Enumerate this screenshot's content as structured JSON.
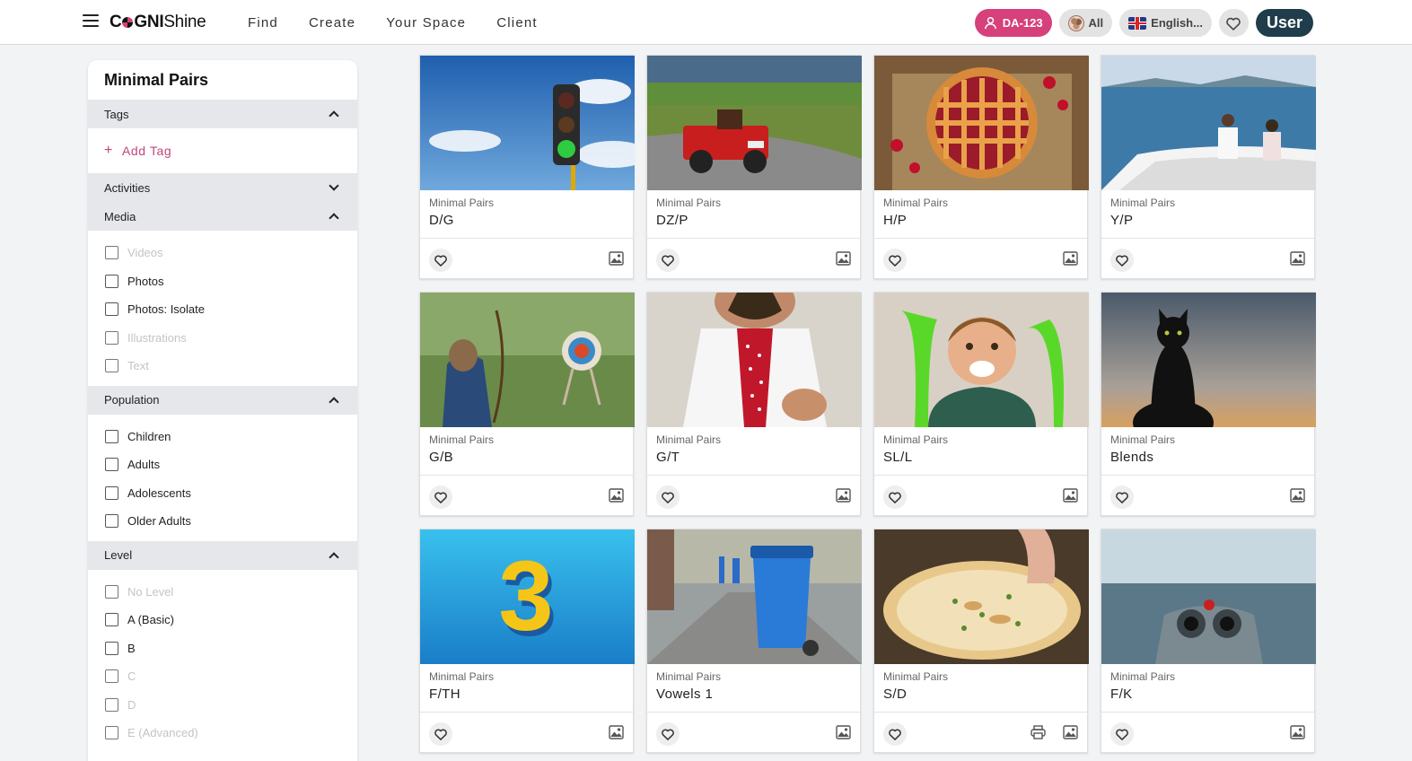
{
  "header": {
    "logo": {
      "part1": "C",
      "part2": "GNI",
      "part3": "Shine"
    },
    "nav": [
      "Find",
      "Create",
      "Your Space",
      "Client"
    ],
    "account_badge": "DA-123",
    "filter_all": "All",
    "language": "English...",
    "user_button": "User"
  },
  "sidebar": {
    "title": "Minimal Pairs",
    "sections": {
      "tags": "Tags",
      "add_tag": "Add Tag",
      "activities": "Activities",
      "media": "Media",
      "population": "Population",
      "level": "Level"
    },
    "media_options": [
      {
        "label": "Videos",
        "disabled": true
      },
      {
        "label": "Photos",
        "disabled": false
      },
      {
        "label": "Photos: Isolate",
        "disabled": false
      },
      {
        "label": "Illustrations",
        "disabled": true
      },
      {
        "label": "Text",
        "disabled": true
      }
    ],
    "population_options": [
      {
        "label": "Children",
        "disabled": false
      },
      {
        "label": "Adults",
        "disabled": false
      },
      {
        "label": "Adolescents",
        "disabled": false
      },
      {
        "label": "Older Adults",
        "disabled": false
      }
    ],
    "level_options": [
      {
        "label": "No Level",
        "disabled": true
      },
      {
        "label": "A (Basic)",
        "disabled": false
      },
      {
        "label": "B",
        "disabled": false
      },
      {
        "label": "C",
        "disabled": true
      },
      {
        "label": "D",
        "disabled": true
      },
      {
        "label": "E (Advanced)",
        "disabled": true
      }
    ]
  },
  "cards": [
    {
      "category": "Minimal Pairs",
      "title": "D/G",
      "image": "traffic-light"
    },
    {
      "category": "Minimal Pairs",
      "title": "DZ/P",
      "image": "red-jeep"
    },
    {
      "category": "Minimal Pairs",
      "title": "H/P",
      "image": "cherry-pie"
    },
    {
      "category": "Minimal Pairs",
      "title": "Y/P",
      "image": "yacht"
    },
    {
      "category": "Minimal Pairs",
      "title": "G/B",
      "image": "archery"
    },
    {
      "category": "Minimal Pairs",
      "title": "G/T",
      "image": "man-tie"
    },
    {
      "category": "Minimal Pairs",
      "title": "SL/L",
      "image": "boy-slime"
    },
    {
      "category": "Minimal Pairs",
      "title": "Blends",
      "image": "black-cat"
    },
    {
      "category": "Minimal Pairs",
      "title": "F/TH",
      "image": "number-three"
    },
    {
      "category": "Minimal Pairs",
      "title": "Vowels 1",
      "image": "trash-bin"
    },
    {
      "category": "Minimal Pairs",
      "title": "S/D",
      "image": "flatbread",
      "printable": true
    },
    {
      "category": "Minimal Pairs",
      "title": "F/K",
      "image": "binoculars"
    }
  ],
  "colors": {
    "accent": "#d6407b",
    "user_button": "#1f3d4a",
    "section_bg": "#e5e7ea"
  }
}
